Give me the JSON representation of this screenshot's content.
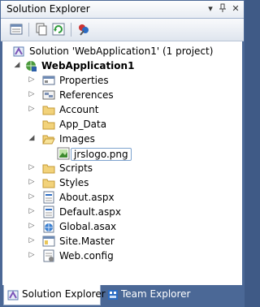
{
  "window": {
    "title": "Solution Explorer"
  },
  "title_buttons": {
    "dropdown": "▾",
    "pin": "📌",
    "close": "✕"
  },
  "toolbar": {
    "buttons": [
      {
        "name": "properties-icon"
      },
      {
        "name": "show-all-files-icon"
      },
      {
        "name": "refresh-icon"
      },
      {
        "name": "view-class-diagram-icon"
      }
    ]
  },
  "tree": {
    "solution": "Solution 'WebApplication1' (1 project)",
    "project": "WebApplication1",
    "items": [
      {
        "label": "Properties",
        "icon": "properties-folder-icon"
      },
      {
        "label": "References",
        "icon": "references-icon"
      },
      {
        "label": "Account",
        "icon": "folder-icon"
      },
      {
        "label": "App_Data",
        "icon": "folder-icon"
      },
      {
        "label": "Images",
        "icon": "folder-open-icon"
      },
      {
        "label": "jrslogo.png",
        "icon": "image-file-icon"
      },
      {
        "label": "Scripts",
        "icon": "folder-icon"
      },
      {
        "label": "Styles",
        "icon": "folder-icon"
      },
      {
        "label": "About.aspx",
        "icon": "aspx-file-icon"
      },
      {
        "label": "Default.aspx",
        "icon": "aspx-file-icon"
      },
      {
        "label": "Global.asax",
        "icon": "asax-file-icon"
      },
      {
        "label": "Site.Master",
        "icon": "master-file-icon"
      },
      {
        "label": "Web.config",
        "icon": "config-file-icon"
      }
    ]
  },
  "tabs": [
    {
      "label": "Solution Explorer",
      "active": true
    },
    {
      "label": "Team Explorer",
      "active": false
    }
  ]
}
